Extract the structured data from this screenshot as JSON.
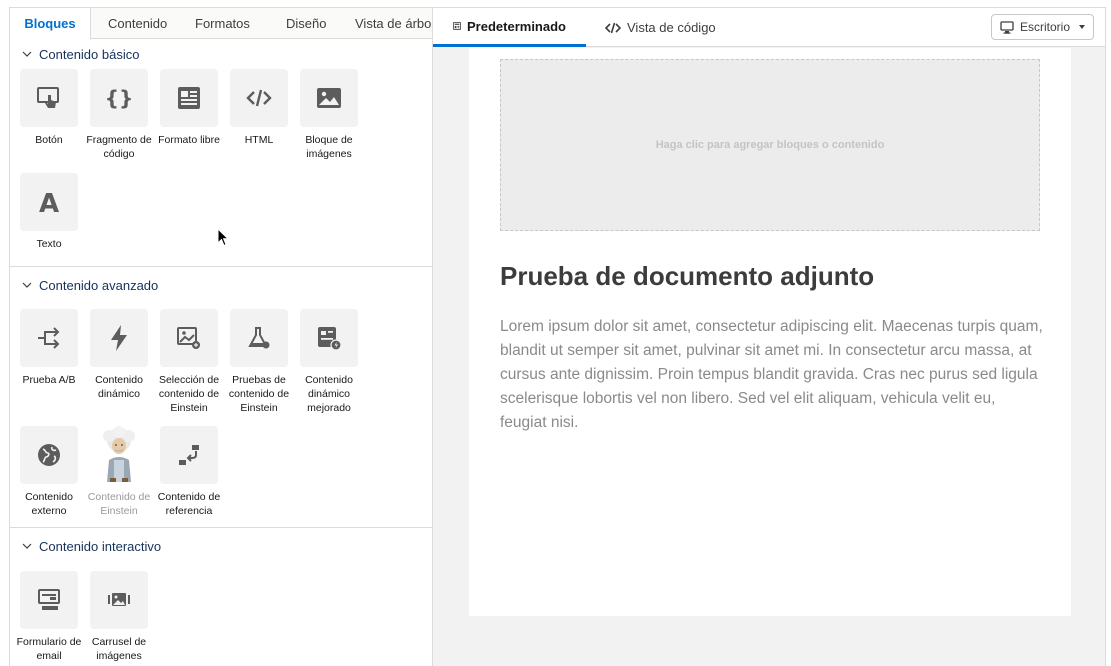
{
  "left_tabs": [
    {
      "label": "Bloques",
      "active": true
    },
    {
      "label": "Contenido",
      "active": false
    },
    {
      "label": "Formatos",
      "active": false
    },
    {
      "label": "Diseño",
      "active": false
    },
    {
      "label": "Vista de árbol",
      "active": false
    }
  ],
  "sections": [
    {
      "title": "Contenido básico",
      "tiles": [
        {
          "label": "Botón",
          "icon": "touch-icon"
        },
        {
          "label": "Fragmento de código",
          "icon": "braces-icon"
        },
        {
          "label": "Formato libre",
          "icon": "article-icon"
        },
        {
          "label": "HTML",
          "icon": "code-icon"
        },
        {
          "label": "Bloque de imágenes",
          "icon": "image-icon"
        },
        {
          "label": "Texto",
          "icon": "text-icon"
        }
      ]
    },
    {
      "title": "Contenido avanzado",
      "tiles": [
        {
          "label": "Prueba A/B",
          "icon": "split-arrows-icon"
        },
        {
          "label": "Contenido dinámico",
          "icon": "lightning-icon"
        },
        {
          "label": "Selección de contenido de Einstein",
          "icon": "image-selection-icon"
        },
        {
          "label": "Pruebas de contenido de Einstein",
          "icon": "flask-icon"
        },
        {
          "label": "Contenido dinámico mejorado",
          "icon": "document-bolt-icon"
        },
        {
          "label": "Contenido externo",
          "icon": "globe-icon"
        },
        {
          "label": "Contenido de Einstein",
          "icon": "einstein-avatar-icon",
          "disabled": true
        },
        {
          "label": "Contenido de referencia",
          "icon": "reference-icon"
        }
      ]
    },
    {
      "title": "Contenido interactivo",
      "tiles": [
        {
          "label": "Formulario de email",
          "icon": "form-icon"
        },
        {
          "label": "Carrusel de imágenes",
          "icon": "carousel-icon"
        }
      ]
    }
  ],
  "view_tabs": [
    {
      "label": "Predeterminado",
      "icon": "layout-icon",
      "active": true
    },
    {
      "label": "Vista de código",
      "icon": "code-icon",
      "active": false
    }
  ],
  "device": {
    "label": "Escritorio",
    "icon": "desktop-icon"
  },
  "canvas": {
    "dropzone_text": "Haga clic para agregar bloques o contenido",
    "title": "Prueba de documento adjunto",
    "body": "Lorem ipsum dolor sit amet, consectetur adipiscing elit. Maecenas turpis quam, blandit ut semper sit amet, pulvinar sit amet mi. In consectetur  arcu massa, at cursus ante dignissim. Proin tempus blandit gravida.  Cras nec purus sed ligula scelerisque lobortis vel non libero. Sed vel  elit aliquam, vehicula velit eu, feugiat nisi."
  },
  "colors": {
    "accent": "#0070d2",
    "icon_gray": "#5c5c5c",
    "tile_bg": "#f3f2f2"
  }
}
